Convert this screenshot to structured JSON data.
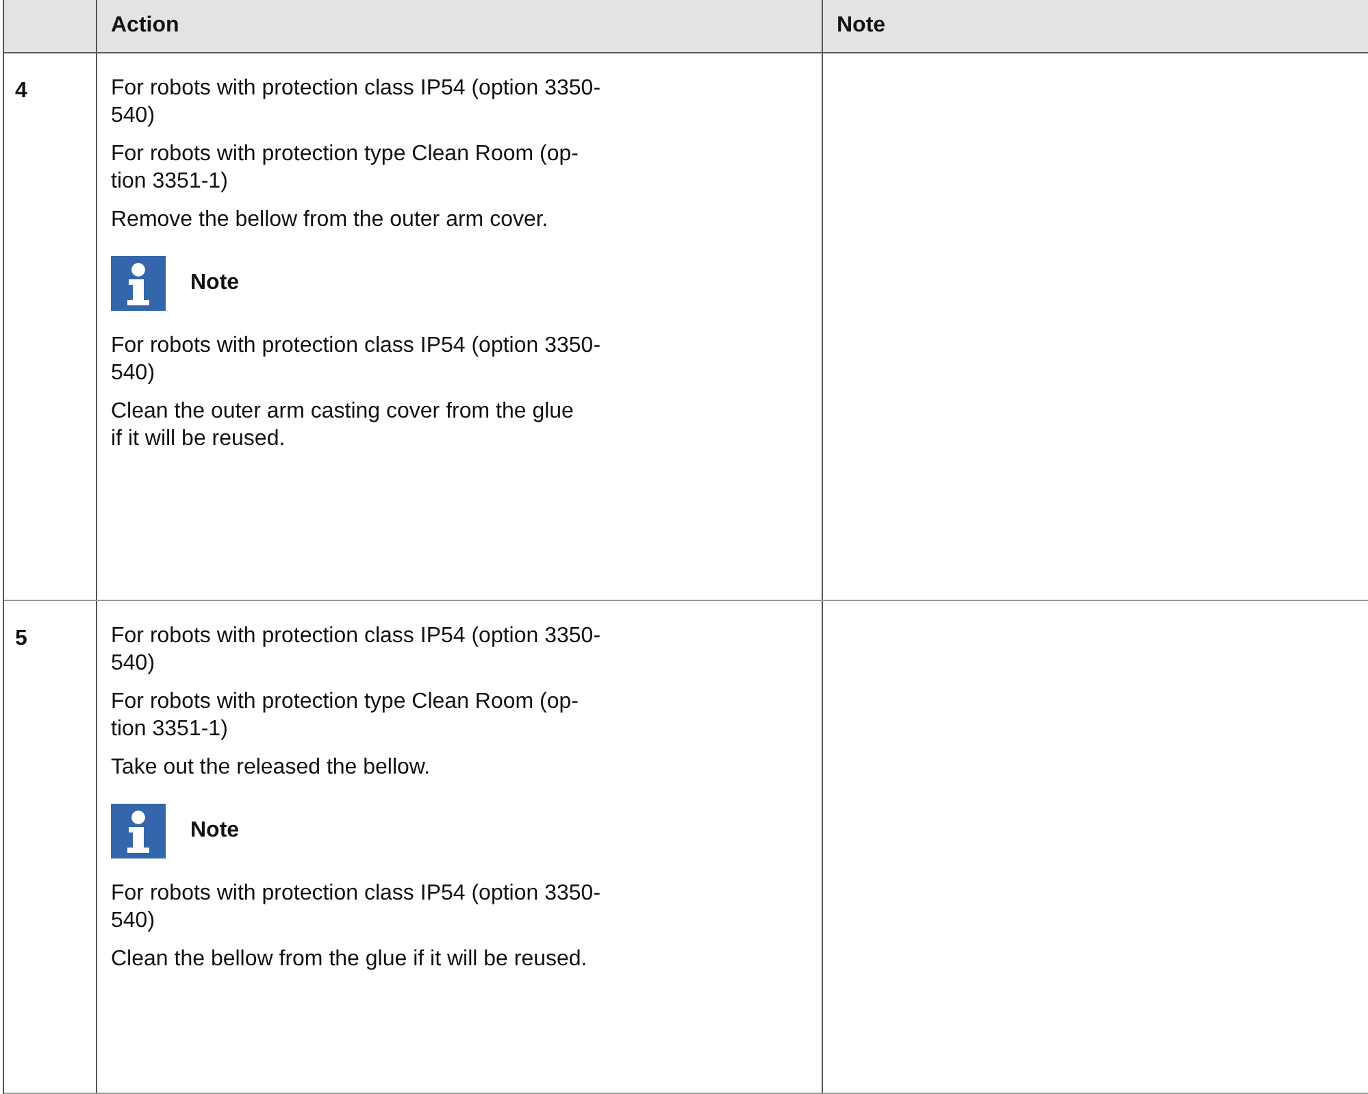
{
  "table": {
    "columns": [
      "Action",
      "Note"
    ],
    "rows": [
      {
        "step": "4",
        "action": [
          {
            "kind": "text",
            "text": "For robots with protection class IP54 (option 3350-\n540)"
          },
          {
            "kind": "text",
            "text": "For robots with protection type Clean Room (op-\ntion 3351-1)"
          },
          {
            "kind": "text",
            "text": "Remove the bellow from the outer arm cover."
          },
          {
            "kind": "note",
            "text": "Note"
          },
          {
            "kind": "text",
            "text": "For robots with protection class IP54 (option 3350-\n540)"
          },
          {
            "kind": "text",
            "text": "Clean the outer arm casting cover from the glue\nif it will be reused."
          }
        ]
      },
      {
        "step": "5",
        "action": [
          {
            "kind": "text",
            "text": "For robots with protection class IP54 (option 3350-\n540)"
          },
          {
            "kind": "text",
            "text": "For robots with protection type Clean Room (op-\ntion 3351-1)"
          },
          {
            "kind": "text",
            "text": "Take out the released the bellow."
          },
          {
            "kind": "note",
            "text": "Note"
          },
          {
            "kind": "text",
            "text": "For robots with protection class IP54 (option 3350-\n540)"
          },
          {
            "kind": "text",
            "text": "Clean the bellow from the glue if it will be reused."
          }
        ]
      }
    ]
  }
}
